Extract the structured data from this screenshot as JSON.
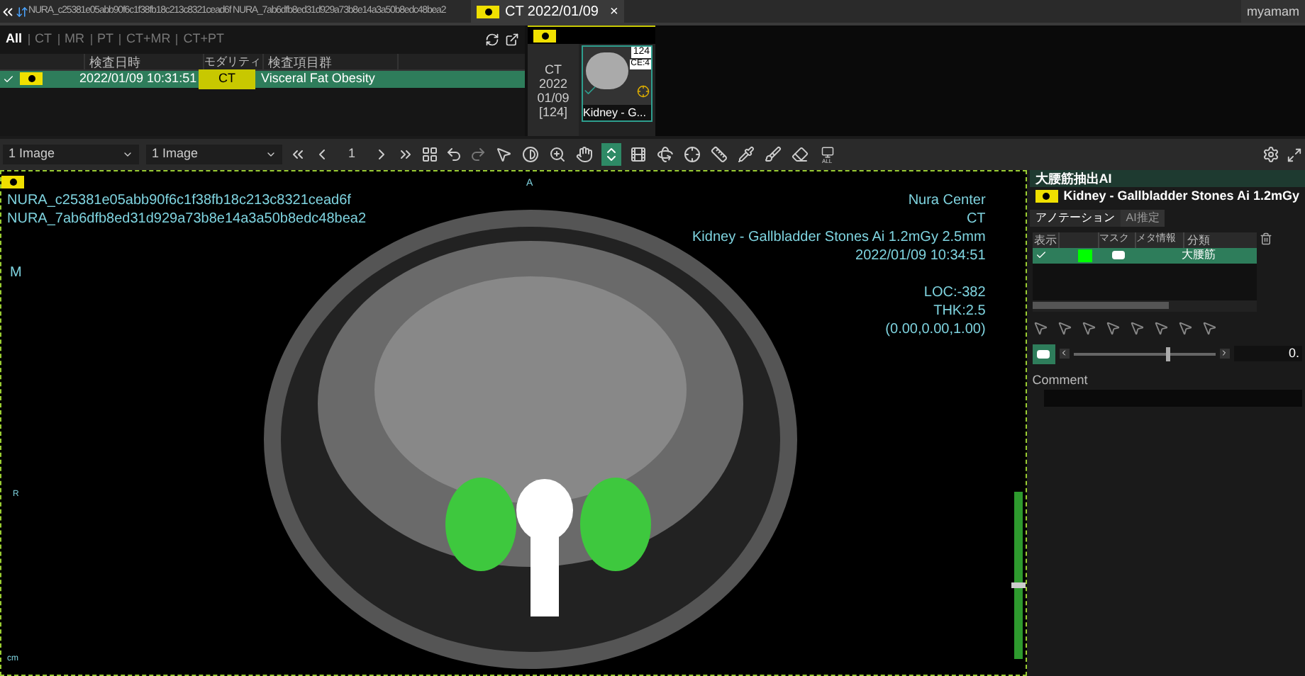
{
  "top_bar": {
    "patient_tab": "NURA_c25381e05abb90f6c1f38fb18c213c8321cead6f NURA_7ab6dfb8ed31d929a73b8e14a3a50b8edc48bea2",
    "study_tab": {
      "label": "CT 2022/01/09",
      "close": "×"
    },
    "user": "myamam"
  },
  "modality_filters": [
    {
      "label": "All",
      "selected": true
    },
    {
      "label": "CT",
      "selected": false
    },
    {
      "label": "MR",
      "selected": false
    },
    {
      "label": "PT",
      "selected": false
    },
    {
      "label": "CT+MR",
      "selected": false
    },
    {
      "label": "CT+PT",
      "selected": false
    }
  ],
  "study_table": {
    "columns": [
      "検査日時",
      "モダリティ",
      "検査項目群"
    ],
    "rows": [
      {
        "checked": true,
        "selected": true,
        "date": "2022/01/09 10:31:51",
        "modality": "CT",
        "group": "Visceral Fat Obesity"
      }
    ]
  },
  "series_panel": {
    "info": [
      "CT",
      "2022",
      "01/09",
      "[124]"
    ],
    "thumbnail": {
      "count": "124",
      "tag": "CE:4",
      "caption": "Kidney - G...",
      "checked": true
    }
  },
  "toolbar": {
    "layout_1": "1 Image",
    "layout_2": "1 Image",
    "page": "1",
    "tools": [
      {
        "kind": "pointer",
        "selected": false
      },
      {
        "kind": "contrast",
        "selected": false
      },
      {
        "kind": "zoom",
        "selected": false
      },
      {
        "kind": "hand",
        "selected": false
      },
      {
        "kind": "scroll",
        "selected": true
      },
      {
        "kind": "film",
        "selected": false
      },
      {
        "kind": "rotate",
        "selected": false
      },
      {
        "kind": "crosshair",
        "selected": false
      },
      {
        "kind": "ruler",
        "selected": false
      },
      {
        "kind": "pipette",
        "selected": false
      },
      {
        "kind": "brush",
        "selected": false
      },
      {
        "kind": "eraser",
        "selected": false
      },
      {
        "kind": "all",
        "selected": false
      }
    ],
    "all_label": "ALL"
  },
  "viewer": {
    "ids": [
      "NURA_c25381e05abb90f6c1f38fb18c213c8321cead6f",
      "NURA_7ab6dfb8ed31d929a73b8e14a3a50b8edc48bea2"
    ],
    "orient_top": "A",
    "orient_left": "M",
    "orient_side": "R",
    "unit": "cm",
    "info_top": [
      "Nura Center",
      "CT",
      "Kidney - Gallbladder Stones Ai 1.2mGy 2.5mm",
      "2022/01/09 10:34:51"
    ],
    "info_mid": [
      "LOC:-382",
      "THK:2.5",
      "(0.00,0.00,1.00)"
    ]
  },
  "ai_panel": {
    "title": "大腰筋抽出AI",
    "series": "Kidney - Gallbladder Stones Ai 1.2mGy",
    "tabs": [
      {
        "label": "アノテーション",
        "selected": true
      },
      {
        "label": "AI推定",
        "selected": false
      }
    ],
    "columns": [
      "表示",
      "マスク",
      "メタ情報",
      "分類"
    ],
    "rows": [
      {
        "checked": true,
        "color": "#00ff00",
        "class": "大腰筋",
        "selected": true
      }
    ],
    "slider": {
      "level": 0.65,
      "value": "0."
    },
    "comment_label": "Comment"
  }
}
